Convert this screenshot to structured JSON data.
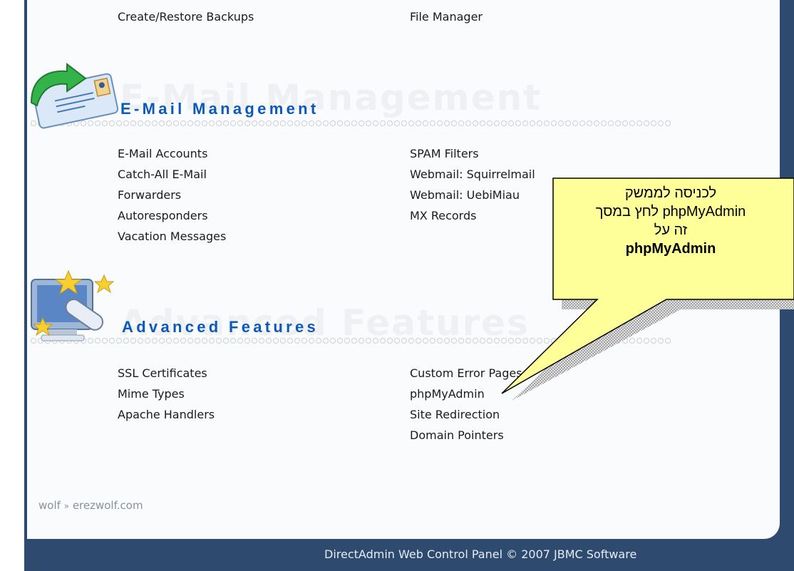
{
  "files_links": {
    "create_restore_backups": "Create/Restore Backups",
    "file_manager": "File Manager"
  },
  "email_section": {
    "title": "E-Mail Management",
    "watermark": "E-Mail Management",
    "left_links": [
      "E-Mail Accounts",
      "Catch-All E-Mail",
      "Forwarders",
      "Autoresponders",
      "Vacation Messages"
    ],
    "right_links": [
      "SPAM Filters",
      "Webmail: Squirrelmail",
      "Webmail: UebiMiau",
      "MX Records"
    ]
  },
  "advanced_section": {
    "title": "Advanced Features",
    "watermark": "Advanced Features",
    "left_links": [
      "SSL Certificates",
      "Mime Types",
      "Apache Handlers"
    ],
    "right_links": [
      "Custom Error Pages",
      "phpMyAdmin",
      "Site Redirection",
      "Domain Pointers"
    ]
  },
  "breadcrumb": {
    "user": "wolf",
    "separator": "»",
    "domain": "erezwolf.com"
  },
  "footer": {
    "text": "DirectAdmin Web Control Panel © 2007 JBMC Software"
  },
  "callout": {
    "line1": "לכניסה לממשק",
    "line2": "phpMyAdmin לחץ במסך",
    "line3": "זה על",
    "line4": "phpMyAdmin",
    "fill_color": "#ffff99"
  },
  "icons": {
    "email_section_icon": "envelope-icon",
    "advanced_section_icon": "monitor-stars-icon"
  },
  "colors": {
    "section_title": "#0b59b8",
    "frame": "#2e4a6e"
  }
}
